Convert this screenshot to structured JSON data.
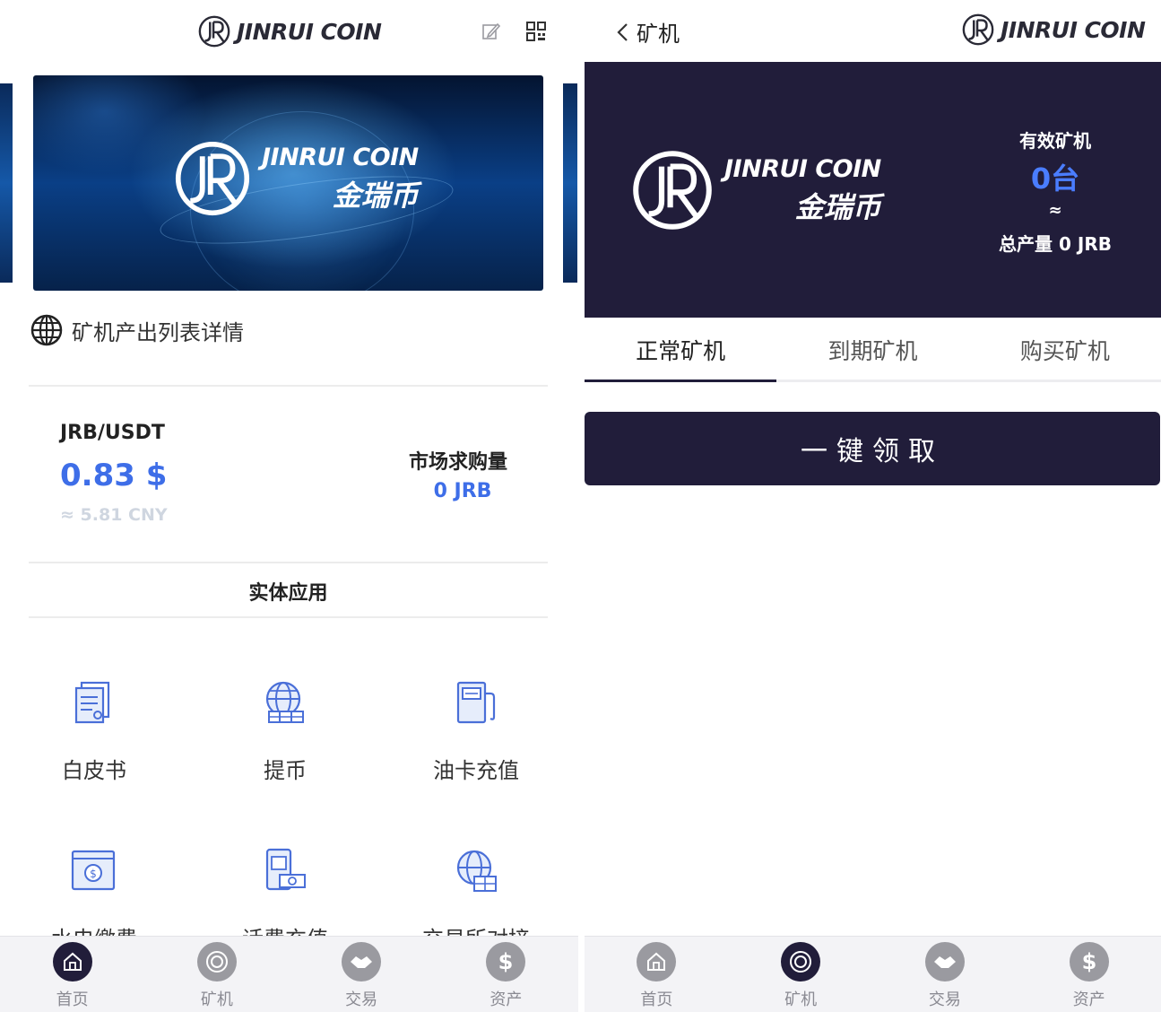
{
  "left": {
    "logo_text": "JINRUI COIN",
    "banner": {
      "brand_en": "JINRUI COIN",
      "brand_cn": "金瑞币"
    },
    "notice": "矿机产出列表详情",
    "market": {
      "pair": "JRB/USDT",
      "price": "0.83 $",
      "cny": "≈ 5.81 CNY",
      "demand_label": "市场求购量",
      "demand_value": "0 JRB"
    },
    "section_title": "实体应用",
    "apps": [
      {
        "label": "白皮书",
        "icon": "document-icon"
      },
      {
        "label": "提币",
        "icon": "globe-coins-icon"
      },
      {
        "label": "油卡充值",
        "icon": "fuel-pump-icon"
      },
      {
        "label": "水电缴费",
        "icon": "bill-coin-icon"
      },
      {
        "label": "话费充值",
        "icon": "phone-cash-icon"
      },
      {
        "label": "交易所对接",
        "icon": "exchange-globe-icon"
      }
    ]
  },
  "right": {
    "back_title": "矿机",
    "logo_text": "JINRUI COIN",
    "hero": {
      "brand_en": "JINRUI COIN",
      "brand_cn": "金瑞币",
      "valid_label": "有效矿机",
      "valid_count": "0台",
      "approx": "≈",
      "total_label": "总产量",
      "total_value": "0",
      "total_unit": "JRB"
    },
    "tabs": [
      "正常矿机",
      "到期矿机",
      "购买矿机"
    ],
    "active_tab": 0,
    "claim_label": "一键领取"
  },
  "nav": {
    "items": [
      {
        "label": "首页",
        "icon": "home-icon"
      },
      {
        "label": "矿机",
        "icon": "miner-icon"
      },
      {
        "label": "交易",
        "icon": "handshake-icon"
      },
      {
        "label": "资产",
        "icon": "dollar-icon"
      }
    ],
    "left_active": 0,
    "right_active": 1
  },
  "colors": {
    "accent_blue": "#3e6ee8",
    "dark_navy": "#211d3a",
    "icon_blue": "#4a6fd8"
  }
}
